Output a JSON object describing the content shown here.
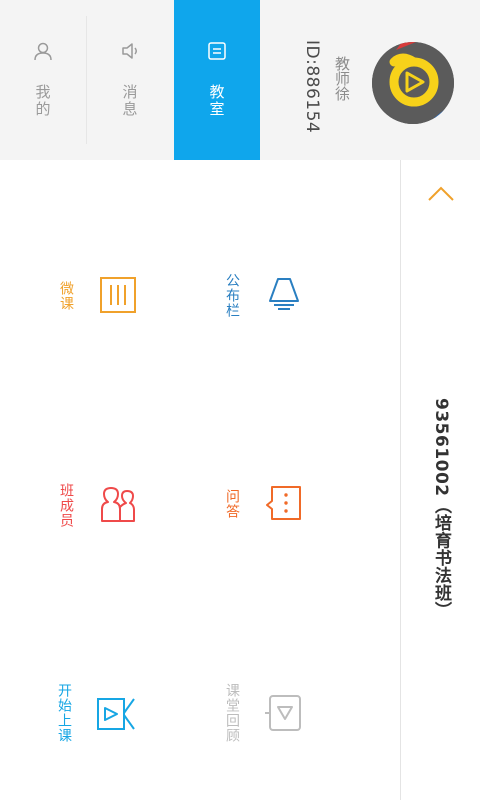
{
  "header": {
    "tabs": [
      {
        "label": "我的",
        "icon": "person-icon"
      },
      {
        "label": "消息",
        "icon": "speaker-icon"
      },
      {
        "label": "教室",
        "icon": "classroom-icon"
      }
    ],
    "active_tab": "教室",
    "user": {
      "name": "教师徐",
      "id": "ID:886154",
      "avatar": "logo-avatar-icon"
    }
  },
  "class_panel": {
    "title": "93561002（培育书法班）",
    "collapse_icon": "chevron-up-icon"
  },
  "functions": [
    {
      "label": "公布栏",
      "icon": "megaphone-icon",
      "color": "#2a7fc1"
    },
    {
      "label": "微课",
      "icon": "micro-lesson-icon",
      "color": "#f0a12b"
    },
    {
      "label": "问答",
      "icon": "chat-bubble-icon",
      "color": "#f06a28"
    },
    {
      "label": "班成员",
      "icon": "members-icon",
      "color": "#ef4a4a"
    },
    {
      "label": "课堂回顾",
      "icon": "replay-icon",
      "color": "#bdbdbd"
    },
    {
      "label": "开始上课",
      "icon": "start-class-icon",
      "color": "#16a6e4"
    }
  ],
  "colors": {
    "accent": "#0fa6ec",
    "header_bg": "#f4f4f4",
    "chevron": "#f0a12b"
  }
}
